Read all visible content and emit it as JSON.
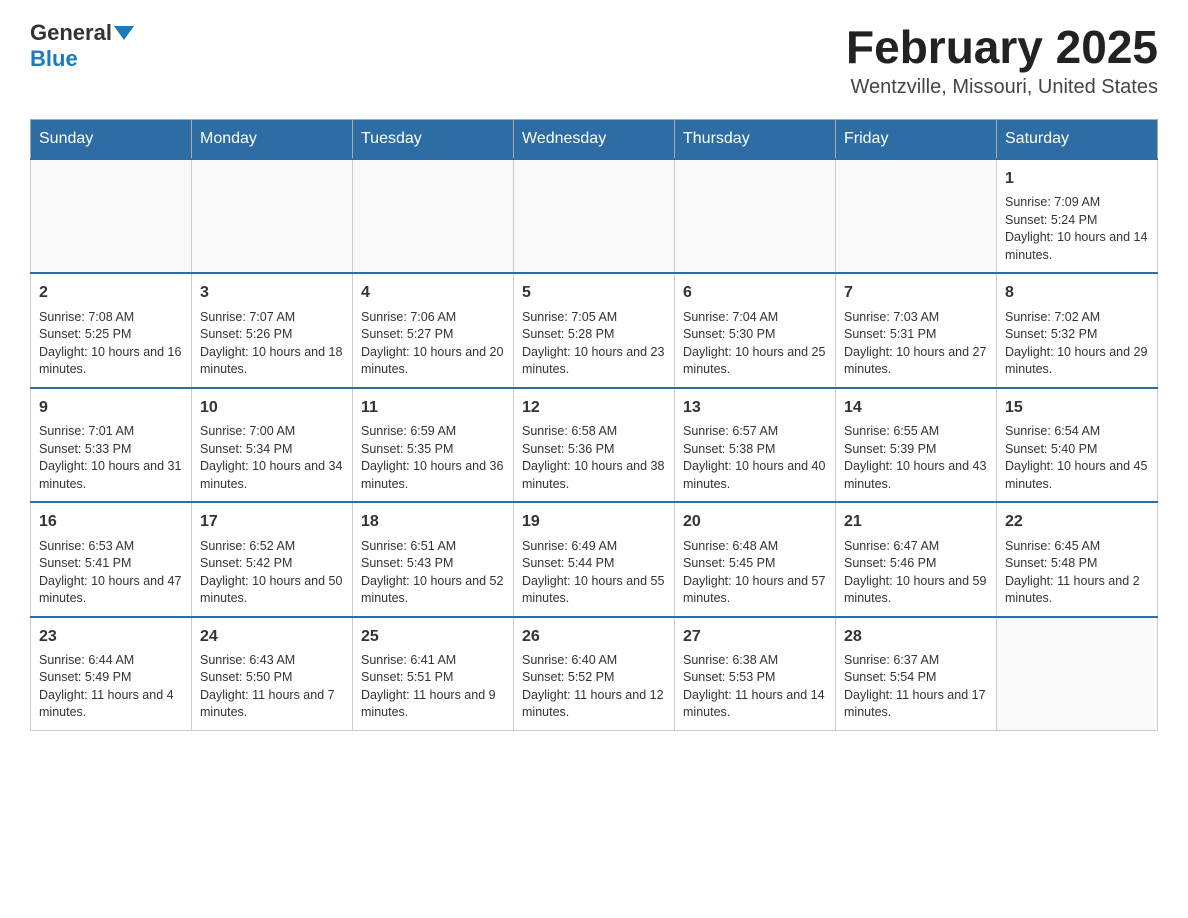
{
  "header": {
    "logo_general": "General",
    "logo_blue": "Blue",
    "month_title": "February 2025",
    "location": "Wentzville, Missouri, United States"
  },
  "days_of_week": [
    "Sunday",
    "Monday",
    "Tuesday",
    "Wednesday",
    "Thursday",
    "Friday",
    "Saturday"
  ],
  "weeks": [
    [
      {
        "day": "",
        "info": ""
      },
      {
        "day": "",
        "info": ""
      },
      {
        "day": "",
        "info": ""
      },
      {
        "day": "",
        "info": ""
      },
      {
        "day": "",
        "info": ""
      },
      {
        "day": "",
        "info": ""
      },
      {
        "day": "1",
        "info": "Sunrise: 7:09 AM\nSunset: 5:24 PM\nDaylight: 10 hours and 14 minutes."
      }
    ],
    [
      {
        "day": "2",
        "info": "Sunrise: 7:08 AM\nSunset: 5:25 PM\nDaylight: 10 hours and 16 minutes."
      },
      {
        "day": "3",
        "info": "Sunrise: 7:07 AM\nSunset: 5:26 PM\nDaylight: 10 hours and 18 minutes."
      },
      {
        "day": "4",
        "info": "Sunrise: 7:06 AM\nSunset: 5:27 PM\nDaylight: 10 hours and 20 minutes."
      },
      {
        "day": "5",
        "info": "Sunrise: 7:05 AM\nSunset: 5:28 PM\nDaylight: 10 hours and 23 minutes."
      },
      {
        "day": "6",
        "info": "Sunrise: 7:04 AM\nSunset: 5:30 PM\nDaylight: 10 hours and 25 minutes."
      },
      {
        "day": "7",
        "info": "Sunrise: 7:03 AM\nSunset: 5:31 PM\nDaylight: 10 hours and 27 minutes."
      },
      {
        "day": "8",
        "info": "Sunrise: 7:02 AM\nSunset: 5:32 PM\nDaylight: 10 hours and 29 minutes."
      }
    ],
    [
      {
        "day": "9",
        "info": "Sunrise: 7:01 AM\nSunset: 5:33 PM\nDaylight: 10 hours and 31 minutes."
      },
      {
        "day": "10",
        "info": "Sunrise: 7:00 AM\nSunset: 5:34 PM\nDaylight: 10 hours and 34 minutes."
      },
      {
        "day": "11",
        "info": "Sunrise: 6:59 AM\nSunset: 5:35 PM\nDaylight: 10 hours and 36 minutes."
      },
      {
        "day": "12",
        "info": "Sunrise: 6:58 AM\nSunset: 5:36 PM\nDaylight: 10 hours and 38 minutes."
      },
      {
        "day": "13",
        "info": "Sunrise: 6:57 AM\nSunset: 5:38 PM\nDaylight: 10 hours and 40 minutes."
      },
      {
        "day": "14",
        "info": "Sunrise: 6:55 AM\nSunset: 5:39 PM\nDaylight: 10 hours and 43 minutes."
      },
      {
        "day": "15",
        "info": "Sunrise: 6:54 AM\nSunset: 5:40 PM\nDaylight: 10 hours and 45 minutes."
      }
    ],
    [
      {
        "day": "16",
        "info": "Sunrise: 6:53 AM\nSunset: 5:41 PM\nDaylight: 10 hours and 47 minutes."
      },
      {
        "day": "17",
        "info": "Sunrise: 6:52 AM\nSunset: 5:42 PM\nDaylight: 10 hours and 50 minutes."
      },
      {
        "day": "18",
        "info": "Sunrise: 6:51 AM\nSunset: 5:43 PM\nDaylight: 10 hours and 52 minutes."
      },
      {
        "day": "19",
        "info": "Sunrise: 6:49 AM\nSunset: 5:44 PM\nDaylight: 10 hours and 55 minutes."
      },
      {
        "day": "20",
        "info": "Sunrise: 6:48 AM\nSunset: 5:45 PM\nDaylight: 10 hours and 57 minutes."
      },
      {
        "day": "21",
        "info": "Sunrise: 6:47 AM\nSunset: 5:46 PM\nDaylight: 10 hours and 59 minutes."
      },
      {
        "day": "22",
        "info": "Sunrise: 6:45 AM\nSunset: 5:48 PM\nDaylight: 11 hours and 2 minutes."
      }
    ],
    [
      {
        "day": "23",
        "info": "Sunrise: 6:44 AM\nSunset: 5:49 PM\nDaylight: 11 hours and 4 minutes."
      },
      {
        "day": "24",
        "info": "Sunrise: 6:43 AM\nSunset: 5:50 PM\nDaylight: 11 hours and 7 minutes."
      },
      {
        "day": "25",
        "info": "Sunrise: 6:41 AM\nSunset: 5:51 PM\nDaylight: 11 hours and 9 minutes."
      },
      {
        "day": "26",
        "info": "Sunrise: 6:40 AM\nSunset: 5:52 PM\nDaylight: 11 hours and 12 minutes."
      },
      {
        "day": "27",
        "info": "Sunrise: 6:38 AM\nSunset: 5:53 PM\nDaylight: 11 hours and 14 minutes."
      },
      {
        "day": "28",
        "info": "Sunrise: 6:37 AM\nSunset: 5:54 PM\nDaylight: 11 hours and 17 minutes."
      },
      {
        "day": "",
        "info": ""
      }
    ]
  ]
}
